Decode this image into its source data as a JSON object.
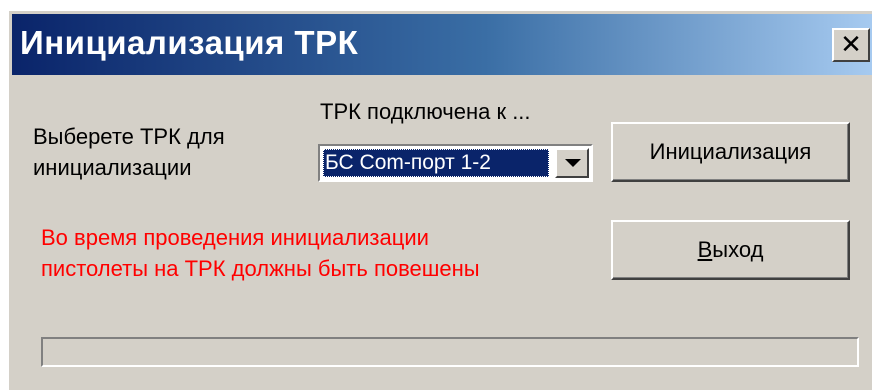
{
  "window": {
    "title": "Инициализация ТРК",
    "close_label": "✕"
  },
  "form": {
    "select_label_line1": "Выберете ТРК для",
    "select_label_line2": "инициализации",
    "connection_label": "ТРК подключена к ...",
    "port_selected": "БС Com-порт 1-2"
  },
  "buttons": {
    "init_label": "Инициализация",
    "exit_label_accel": "В",
    "exit_label_rest": "ыход"
  },
  "warning": {
    "line1": "Во время проведения инициализации",
    "line2": "пистолеты на ТРК должны быть повешены",
    "color": "#ff0000"
  },
  "progress": {
    "value_percent": 0
  },
  "colors": {
    "titlebar_start": "#0a246a",
    "titlebar_end": "#a6caf0",
    "face": "#d4d0c8"
  }
}
